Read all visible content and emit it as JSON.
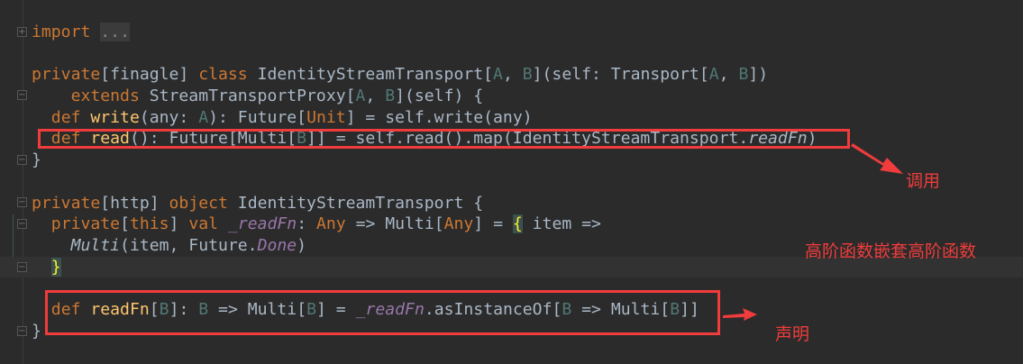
{
  "code": {
    "lines": [
      {
        "tokens": [
          [
            "kw",
            "import"
          ],
          [
            "",
            ""
          ],
          [
            "plain",
            " "
          ],
          [
            "fold",
            "..."
          ]
        ]
      },
      {
        "tokens": []
      },
      {
        "tokens": [
          [
            "kw",
            "private"
          ],
          [
            "",
            "[finagle] "
          ],
          [
            "kw",
            "class "
          ],
          [
            "",
            "IdentityStreamTransport["
          ],
          [
            "tp",
            "A"
          ],
          [
            "",
            ", "
          ],
          [
            "tp",
            "B"
          ],
          [
            "",
            "](self: Transport["
          ],
          [
            "tp",
            "A"
          ],
          [
            "",
            ", "
          ],
          [
            "tp",
            "B"
          ],
          [
            "",
            "])"
          ]
        ]
      },
      {
        "tokens": [
          [
            "",
            "    "
          ],
          [
            "kw",
            "extends "
          ],
          [
            "",
            "StreamTransportProxy["
          ],
          [
            "tp",
            "A"
          ],
          [
            "",
            ", "
          ],
          [
            "tp",
            "B"
          ],
          [
            "",
            "](self) {"
          ]
        ]
      },
      {
        "tokens": [
          [
            "",
            "  "
          ],
          [
            "kw",
            "def "
          ],
          [
            "fn",
            "write"
          ],
          [
            "",
            "(any: "
          ],
          [
            "tp",
            "A"
          ],
          [
            "",
            "): Future["
          ],
          [
            "kw",
            "Unit"
          ],
          [
            "",
            "] = self.write(any)"
          ]
        ]
      },
      {
        "tokens": [
          [
            "",
            "  "
          ],
          [
            "kw",
            "def "
          ],
          [
            "fn",
            "read"
          ],
          [
            "",
            "(): Future[Multi["
          ],
          [
            "tp",
            "B"
          ],
          [
            "",
            "]] = self.read().map(IdentityStreamTransport."
          ],
          [
            "it",
            "readFn"
          ],
          [
            "",
            ")"
          ]
        ]
      },
      {
        "tokens": [
          [
            "",
            "}"
          ]
        ]
      },
      {
        "tokens": []
      },
      {
        "tokens": [
          [
            "kw",
            "private"
          ],
          [
            "",
            "[http] "
          ],
          [
            "kw",
            "object "
          ],
          [
            "",
            "IdentityStreamTransport {"
          ]
        ]
      },
      {
        "tokens": [
          [
            "",
            "  "
          ],
          [
            "kw",
            "private"
          ],
          [
            "",
            "["
          ],
          [
            "kw",
            "this"
          ],
          [
            "",
            "] "
          ],
          [
            "kw",
            "val "
          ],
          [
            "pv",
            "_readFn"
          ],
          [
            "",
            ": "
          ],
          [
            "kw",
            "Any"
          ],
          [
            "",
            "",
            " "
          ],
          [
            "",
            " => Multi["
          ],
          [
            "kw",
            "Any"
          ],
          [
            "",
            "] = "
          ],
          [
            "brace",
            "{"
          ],
          [
            "",
            " item =>"
          ]
        ]
      },
      {
        "tokens": [
          [
            "",
            "    "
          ],
          [
            "it",
            "Multi"
          ],
          [
            "",
            "(item, Future."
          ],
          [
            "pv",
            "Done"
          ],
          [
            "",
            ")"
          ]
        ]
      },
      {
        "tokens": [
          [
            "",
            "  "
          ],
          [
            "brace",
            "}"
          ]
        ]
      },
      {
        "tokens": []
      },
      {
        "tokens": [
          [
            "",
            "  "
          ],
          [
            "kw",
            "def "
          ],
          [
            "fn",
            "readFn"
          ],
          [
            "",
            "["
          ],
          [
            "tp",
            "B"
          ],
          [
            "",
            "]: "
          ],
          [
            "tp",
            "B"
          ],
          [
            "",
            " => Multi["
          ],
          [
            "tp",
            "B"
          ],
          [
            "",
            "] = "
          ],
          [
            "pv",
            "_readFn"
          ],
          [
            "",
            ".asInstanceOf["
          ],
          [
            "tp",
            "B"
          ],
          [
            "",
            " => Multi["
          ],
          [
            "tp",
            "B"
          ],
          [
            "",
            "]]"
          ]
        ]
      },
      {
        "tokens": [
          [
            "",
            "}"
          ]
        ]
      }
    ]
  },
  "annotations": {
    "call": "调用",
    "nested": "高阶函数嵌套高阶函数",
    "declare": "声明"
  },
  "colors": {
    "background": "#2b2b2b",
    "keyword": "#cc7832",
    "text": "#a9b7c6",
    "type_param": "#507874",
    "method": "#ffc66d",
    "field": "#9876aa",
    "annotation": "#f03c3c"
  }
}
